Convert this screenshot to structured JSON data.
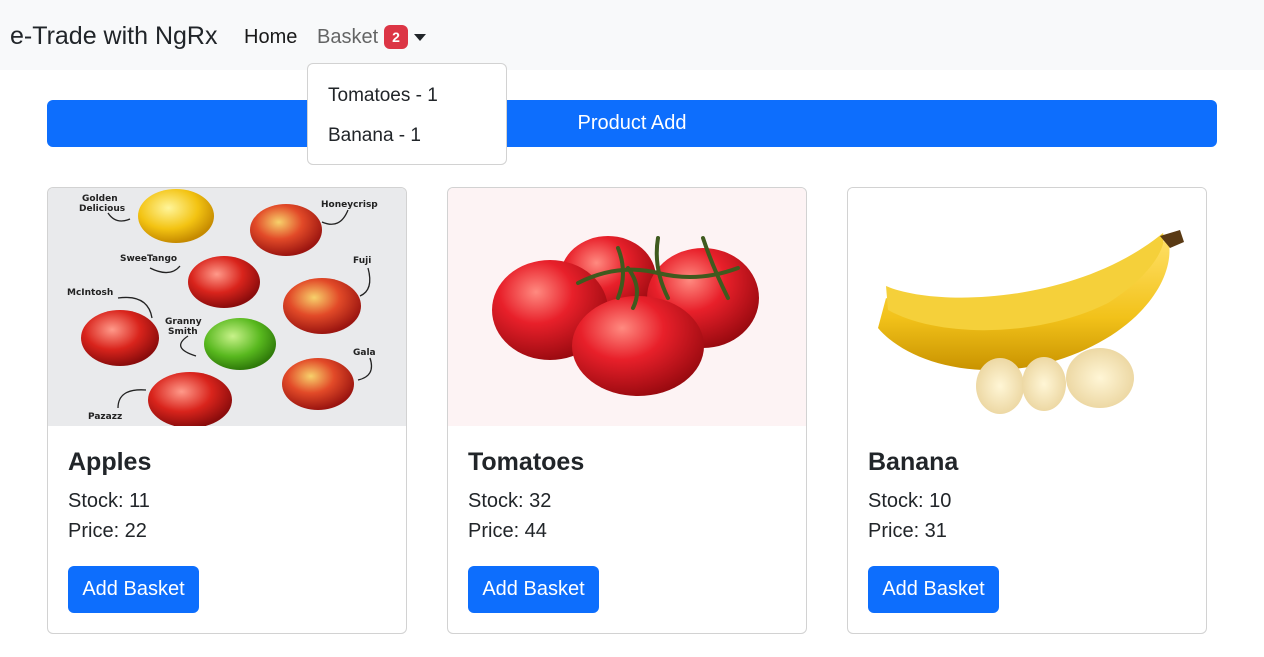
{
  "navbar": {
    "brand": "e-Trade with NgRx",
    "home_label": "Home",
    "basket_label": "Basket",
    "basket_count": "2"
  },
  "basket_dropdown": {
    "items": [
      {
        "label": "Tomatoes - 1"
      },
      {
        "label": "Banana - 1"
      }
    ]
  },
  "product_add_label": "Product Add",
  "apple_image_labels": [
    "Golden",
    "Delicious",
    "Honeycrisp",
    "SweeTango",
    "Fuji",
    "McIntosh",
    "Granny",
    "Smith",
    "Gala",
    "Pazazz"
  ],
  "products": [
    {
      "name": "Apples",
      "stock": "Stock: 11",
      "price": "Price: 22",
      "button": "Add Basket"
    },
    {
      "name": "Tomatoes",
      "stock": "Stock: 32",
      "price": "Price: 44",
      "button": "Add Basket"
    },
    {
      "name": "Banana",
      "stock": "Stock: 10",
      "price": "Price: 31",
      "button": "Add Basket"
    }
  ],
  "colors": {
    "primary": "#0d6efd",
    "badge": "#dc3545",
    "navbar_bg": "#f8f9fa"
  }
}
